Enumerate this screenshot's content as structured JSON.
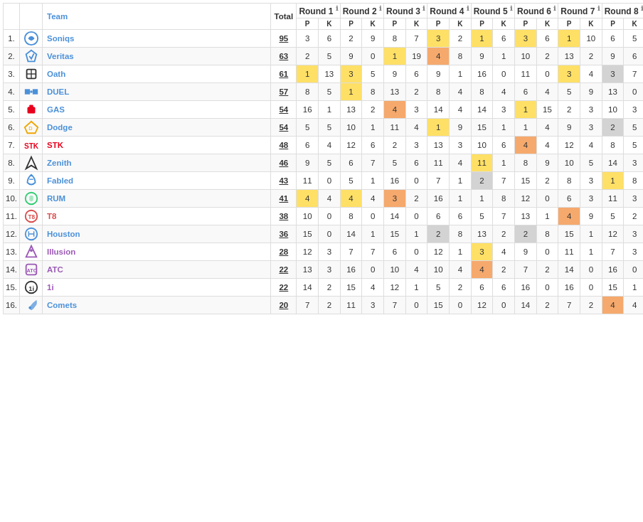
{
  "columns": {
    "rank": "#",
    "team": "Team",
    "total": "Total",
    "rounds": [
      "Round 1",
      "Round 2",
      "Round 3",
      "Round 4",
      "Round 5",
      "Round 6",
      "Round 7",
      "Round 8"
    ],
    "sub": "P",
    "sub2": "K"
  },
  "teams": [
    {
      "rank": "1.",
      "name": "Soniqs",
      "total": "95",
      "color": "#4a90d9",
      "rounds": [
        {
          "p": "3",
          "k": "6",
          "ph": "",
          "kh": ""
        },
        {
          "p": "2",
          "k": "9",
          "ph": "",
          "kh": ""
        },
        {
          "p": "8",
          "k": "7",
          "ph": "",
          "kh": ""
        },
        {
          "p": "3",
          "k": "2",
          "ph": "yellow",
          "kh": ""
        },
        {
          "p": "1",
          "k": "6",
          "ph": "yellow",
          "kh": ""
        },
        {
          "p": "3",
          "k": "6",
          "ph": "yellow",
          "kh": ""
        },
        {
          "p": "1",
          "k": "10",
          "ph": "yellow",
          "kh": ""
        },
        {
          "p": "6",
          "k": "5",
          "ph": "",
          "kh": ""
        }
      ]
    },
    {
      "rank": "2.",
      "name": "Veritas",
      "total": "63",
      "color": "#4a90d9",
      "rounds": [
        {
          "p": "2",
          "k": "5",
          "ph": "",
          "kh": ""
        },
        {
          "p": "9",
          "k": "0",
          "ph": "",
          "kh": ""
        },
        {
          "p": "1",
          "k": "19",
          "ph": "yellow",
          "kh": ""
        },
        {
          "p": "4",
          "k": "8",
          "ph": "orange",
          "kh": ""
        },
        {
          "p": "9",
          "k": "1",
          "ph": "",
          "kh": ""
        },
        {
          "p": "10",
          "k": "2",
          "ph": "",
          "kh": ""
        },
        {
          "p": "13",
          "k": "2",
          "ph": "",
          "kh": ""
        },
        {
          "p": "9",
          "k": "6",
          "ph": "",
          "kh": ""
        }
      ]
    },
    {
      "rank": "3.",
      "name": "Oath",
      "total": "61",
      "color": "#4a90d9",
      "rounds": [
        {
          "p": "1",
          "k": "13",
          "ph": "yellow",
          "kh": ""
        },
        {
          "p": "3",
          "k": "5",
          "ph": "yellow",
          "kh": ""
        },
        {
          "p": "9",
          "k": "6",
          "ph": "",
          "kh": ""
        },
        {
          "p": "9",
          "k": "1",
          "ph": "",
          "kh": ""
        },
        {
          "p": "16",
          "k": "0",
          "ph": "",
          "kh": ""
        },
        {
          "p": "11",
          "k": "0",
          "ph": "",
          "kh": ""
        },
        {
          "p": "3",
          "k": "4",
          "ph": "yellow",
          "kh": ""
        },
        {
          "p": "3",
          "k": "7",
          "ph": "gray",
          "kh": ""
        }
      ]
    },
    {
      "rank": "4.",
      "name": "DUEL",
      "total": "57",
      "color": "#4a90d9",
      "rounds": [
        {
          "p": "8",
          "k": "5",
          "ph": "",
          "kh": ""
        },
        {
          "p": "1",
          "k": "8",
          "ph": "yellow",
          "kh": ""
        },
        {
          "p": "13",
          "k": "2",
          "ph": "",
          "kh": ""
        },
        {
          "p": "8",
          "k": "4",
          "ph": "",
          "kh": ""
        },
        {
          "p": "8",
          "k": "4",
          "ph": "",
          "kh": ""
        },
        {
          "p": "6",
          "k": "4",
          "ph": "",
          "kh": ""
        },
        {
          "p": "5",
          "k": "9",
          "ph": "",
          "kh": ""
        },
        {
          "p": "13",
          "k": "0",
          "ph": "",
          "kh": ""
        }
      ]
    },
    {
      "rank": "5.",
      "name": "GAS",
      "total": "54",
      "color": "#4a90d9",
      "rounds": [
        {
          "p": "16",
          "k": "1",
          "ph": "",
          "kh": ""
        },
        {
          "p": "13",
          "k": "2",
          "ph": "",
          "kh": ""
        },
        {
          "p": "4",
          "k": "3",
          "ph": "orange",
          "kh": ""
        },
        {
          "p": "14",
          "k": "4",
          "ph": "",
          "kh": ""
        },
        {
          "p": "14",
          "k": "3",
          "ph": "",
          "kh": ""
        },
        {
          "p": "1",
          "k": "15",
          "ph": "yellow",
          "kh": ""
        },
        {
          "p": "2",
          "k": "3",
          "ph": "",
          "kh": ""
        },
        {
          "p": "10",
          "k": "3",
          "ph": "",
          "kh": ""
        }
      ]
    },
    {
      "rank": "6.",
      "name": "Dodge",
      "total": "54",
      "color": "#4a90d9",
      "rounds": [
        {
          "p": "5",
          "k": "5",
          "ph": "",
          "kh": ""
        },
        {
          "p": "10",
          "k": "1",
          "ph": "",
          "kh": ""
        },
        {
          "p": "11",
          "k": "4",
          "ph": "",
          "kh": ""
        },
        {
          "p": "1",
          "k": "9",
          "ph": "yellow",
          "kh": ""
        },
        {
          "p": "15",
          "k": "1",
          "ph": "",
          "kh": ""
        },
        {
          "p": "1",
          "k": "4",
          "ph": "",
          "kh": ""
        },
        {
          "p": "9",
          "k": "3",
          "ph": "",
          "kh": ""
        },
        {
          "p": "2",
          "k": "5",
          "ph": "gray",
          "kh": ""
        }
      ]
    },
    {
      "rank": "7.",
      "name": "STK",
      "total": "48",
      "color": "#e8001c",
      "rounds": [
        {
          "p": "6",
          "k": "4",
          "ph": "",
          "kh": ""
        },
        {
          "p": "12",
          "k": "6",
          "ph": "",
          "kh": ""
        },
        {
          "p": "2",
          "k": "3",
          "ph": "",
          "kh": ""
        },
        {
          "p": "13",
          "k": "3",
          "ph": "",
          "kh": ""
        },
        {
          "p": "10",
          "k": "6",
          "ph": "",
          "kh": ""
        },
        {
          "p": "4",
          "k": "4",
          "ph": "orange",
          "kh": ""
        },
        {
          "p": "12",
          "k": "4",
          "ph": "",
          "kh": ""
        },
        {
          "p": "8",
          "k": "5",
          "ph": "",
          "kh": ""
        }
      ]
    },
    {
      "rank": "8.",
      "name": "Zenith",
      "total": "46",
      "color": "#4a90d9",
      "rounds": [
        {
          "p": "9",
          "k": "5",
          "ph": "",
          "kh": ""
        },
        {
          "p": "6",
          "k": "7",
          "ph": "",
          "kh": ""
        },
        {
          "p": "5",
          "k": "6",
          "ph": "",
          "kh": ""
        },
        {
          "p": "11",
          "k": "4",
          "ph": "",
          "kh": ""
        },
        {
          "p": "11",
          "k": "1",
          "ph": "yellow",
          "kh": ""
        },
        {
          "p": "8",
          "k": "9",
          "ph": "",
          "kh": ""
        },
        {
          "p": "10",
          "k": "5",
          "ph": "",
          "kh": ""
        },
        {
          "p": "14",
          "k": "3",
          "ph": "",
          "kh": ""
        }
      ]
    },
    {
      "rank": "9.",
      "name": "Fabled",
      "total": "43",
      "color": "#4a90d9",
      "rounds": [
        {
          "p": "11",
          "k": "0",
          "ph": "",
          "kh": ""
        },
        {
          "p": "5",
          "k": "1",
          "ph": "",
          "kh": ""
        },
        {
          "p": "16",
          "k": "0",
          "ph": "",
          "kh": ""
        },
        {
          "p": "7",
          "k": "1",
          "ph": "",
          "kh": ""
        },
        {
          "p": "2",
          "k": "7",
          "ph": "gray",
          "kh": ""
        },
        {
          "p": "15",
          "k": "2",
          "ph": "",
          "kh": ""
        },
        {
          "p": "8",
          "k": "3",
          "ph": "",
          "kh": ""
        },
        {
          "p": "1",
          "k": "8",
          "ph": "yellow",
          "kh": ""
        }
      ]
    },
    {
      "rank": "10.",
      "name": "RUM",
      "total": "41",
      "color": "#4a90d9",
      "rounds": [
        {
          "p": "4",
          "k": "4",
          "ph": "yellow",
          "kh": ""
        },
        {
          "p": "4",
          "k": "4",
          "ph": "yellow",
          "kh": ""
        },
        {
          "p": "3",
          "k": "2",
          "ph": "orange",
          "kh": ""
        },
        {
          "p": "16",
          "k": "1",
          "ph": "",
          "kh": ""
        },
        {
          "p": "1",
          "k": "8",
          "ph": "",
          "kh": ""
        },
        {
          "p": "12",
          "k": "0",
          "ph": "",
          "kh": ""
        },
        {
          "p": "6",
          "k": "3",
          "ph": "",
          "kh": ""
        },
        {
          "p": "11",
          "k": "3",
          "ph": "",
          "kh": ""
        }
      ]
    },
    {
      "rank": "11.",
      "name": "T8",
      "total": "38",
      "color": "#d94a4a",
      "rounds": [
        {
          "p": "10",
          "k": "0",
          "ph": "",
          "kh": ""
        },
        {
          "p": "8",
          "k": "0",
          "ph": "",
          "kh": ""
        },
        {
          "p": "14",
          "k": "0",
          "ph": "",
          "kh": ""
        },
        {
          "p": "6",
          "k": "6",
          "ph": "",
          "kh": ""
        },
        {
          "p": "5",
          "k": "7",
          "ph": "",
          "kh": ""
        },
        {
          "p": "13",
          "k": "1",
          "ph": "",
          "kh": ""
        },
        {
          "p": "4",
          "k": "9",
          "ph": "orange",
          "kh": ""
        },
        {
          "p": "5",
          "k": "2",
          "ph": "",
          "kh": ""
        }
      ]
    },
    {
      "rank": "12.",
      "name": "Houston",
      "total": "36",
      "color": "#4a90d9",
      "rounds": [
        {
          "p": "15",
          "k": "0",
          "ph": "",
          "kh": ""
        },
        {
          "p": "14",
          "k": "1",
          "ph": "",
          "kh": ""
        },
        {
          "p": "15",
          "k": "1",
          "ph": "",
          "kh": ""
        },
        {
          "p": "2",
          "k": "8",
          "ph": "gray",
          "kh": ""
        },
        {
          "p": "13",
          "k": "2",
          "ph": "",
          "kh": ""
        },
        {
          "p": "2",
          "k": "8",
          "ph": "gray",
          "kh": ""
        },
        {
          "p": "15",
          "k": "1",
          "ph": "",
          "kh": ""
        },
        {
          "p": "12",
          "k": "3",
          "ph": "",
          "kh": ""
        }
      ]
    },
    {
      "rank": "13.",
      "name": "Illusion",
      "total": "28",
      "color": "#9b59b6",
      "rounds": [
        {
          "p": "12",
          "k": "3",
          "ph": "",
          "kh": ""
        },
        {
          "p": "7",
          "k": "7",
          "ph": "",
          "kh": ""
        },
        {
          "p": "6",
          "k": "0",
          "ph": "",
          "kh": ""
        },
        {
          "p": "12",
          "k": "1",
          "ph": "",
          "kh": ""
        },
        {
          "p": "3",
          "k": "4",
          "ph": "yellow",
          "kh": ""
        },
        {
          "p": "9",
          "k": "0",
          "ph": "",
          "kh": ""
        },
        {
          "p": "11",
          "k": "1",
          "ph": "",
          "kh": ""
        },
        {
          "p": "7",
          "k": "3",
          "ph": "",
          "kh": ""
        }
      ]
    },
    {
      "rank": "14.",
      "name": "ATC",
      "total": "22",
      "color": "#9b59b6",
      "rounds": [
        {
          "p": "13",
          "k": "3",
          "ph": "",
          "kh": ""
        },
        {
          "p": "16",
          "k": "0",
          "ph": "",
          "kh": ""
        },
        {
          "p": "10",
          "k": "4",
          "ph": "",
          "kh": ""
        },
        {
          "p": "10",
          "k": "4",
          "ph": "",
          "kh": ""
        },
        {
          "p": "4",
          "k": "2",
          "ph": "orange",
          "kh": ""
        },
        {
          "p": "7",
          "k": "2",
          "ph": "",
          "kh": ""
        },
        {
          "p": "14",
          "k": "0",
          "ph": "",
          "kh": ""
        },
        {
          "p": "16",
          "k": "0",
          "ph": "",
          "kh": ""
        }
      ]
    },
    {
      "rank": "15.",
      "name": "1i",
      "total": "22",
      "color": "#9b59b6",
      "rounds": [
        {
          "p": "14",
          "k": "2",
          "ph": "",
          "kh": ""
        },
        {
          "p": "15",
          "k": "4",
          "ph": "",
          "kh": ""
        },
        {
          "p": "12",
          "k": "1",
          "ph": "",
          "kh": ""
        },
        {
          "p": "5",
          "k": "2",
          "ph": "",
          "kh": ""
        },
        {
          "p": "6",
          "k": "6",
          "ph": "",
          "kh": ""
        },
        {
          "p": "16",
          "k": "0",
          "ph": "",
          "kh": ""
        },
        {
          "p": "16",
          "k": "0",
          "ph": "",
          "kh": ""
        },
        {
          "p": "15",
          "k": "1",
          "ph": "",
          "kh": ""
        }
      ]
    },
    {
      "rank": "16.",
      "name": "Comets",
      "total": "20",
      "color": "#4a90d9",
      "rounds": [
        {
          "p": "7",
          "k": "2",
          "ph": "",
          "kh": ""
        },
        {
          "p": "11",
          "k": "3",
          "ph": "",
          "kh": ""
        },
        {
          "p": "7",
          "k": "0",
          "ph": "",
          "kh": ""
        },
        {
          "p": "15",
          "k": "0",
          "ph": "",
          "kh": ""
        },
        {
          "p": "12",
          "k": "0",
          "ph": "",
          "kh": ""
        },
        {
          "p": "14",
          "k": "2",
          "ph": "",
          "kh": ""
        },
        {
          "p": "7",
          "k": "2",
          "ph": "",
          "kh": ""
        },
        {
          "p": "4",
          "k": "4",
          "ph": "orange",
          "kh": ""
        }
      ]
    }
  ],
  "colors": {
    "yellow": "#ffe066",
    "orange": "#f6a96c",
    "gray": "#d3d3d3",
    "header_bg": "#ffffff",
    "row_alt": "#f9f9f9"
  }
}
